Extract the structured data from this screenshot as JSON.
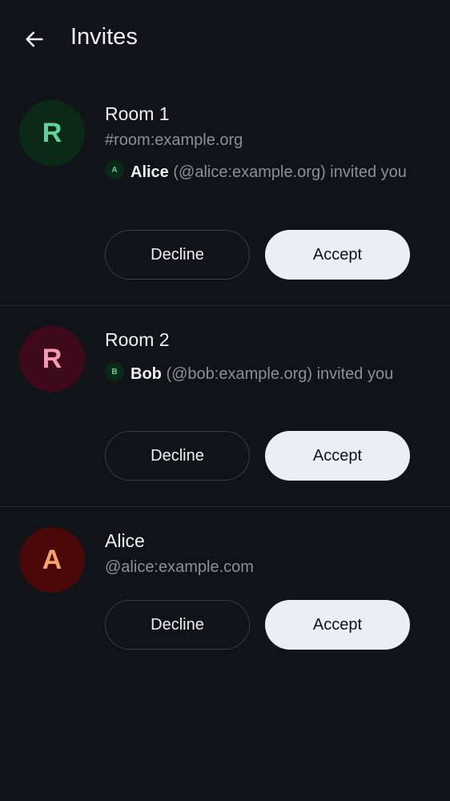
{
  "header": {
    "title": "Invites"
  },
  "colors": {
    "background": "#101317",
    "accent_button": "#ebeef2"
  },
  "invites": [
    {
      "avatar_letter": "R",
      "name": "Room 1",
      "alias": "#room:example.org",
      "inviter": {
        "avatar_letter": "A",
        "display_name": "Alice",
        "user_id_text": "(@alice:example.org) invited you"
      },
      "decline_label": "Decline",
      "accept_label": "Accept"
    },
    {
      "avatar_letter": "R",
      "name": "Room 2",
      "inviter": {
        "avatar_letter": "B",
        "display_name": "Bob",
        "user_id_text": "(@bob:example.org) invited you"
      },
      "decline_label": "Decline",
      "accept_label": "Accept"
    },
    {
      "avatar_letter": "A",
      "name": "Alice",
      "alias": "@alice:example.com",
      "decline_label": "Decline",
      "accept_label": "Accept"
    }
  ]
}
